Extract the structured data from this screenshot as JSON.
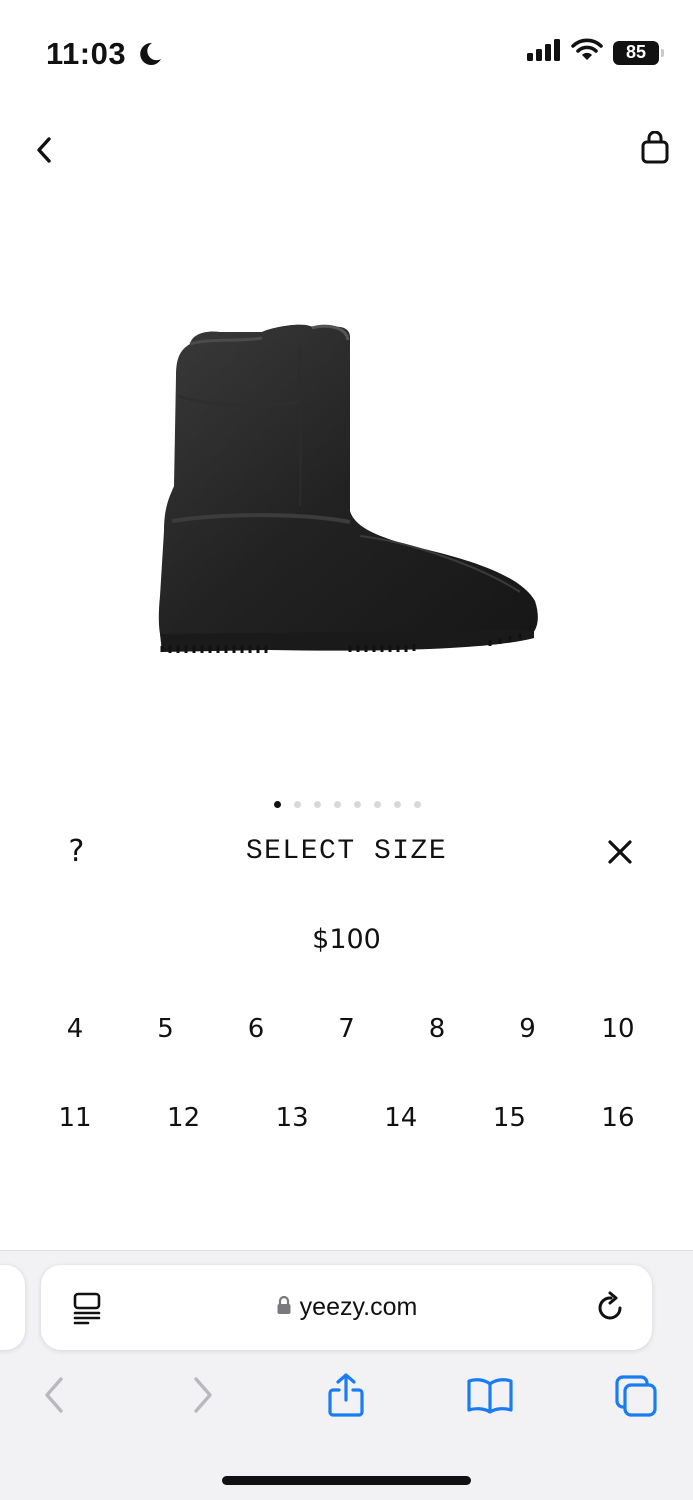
{
  "status_bar": {
    "time": "11:03",
    "battery": "85"
  },
  "product": {
    "image_alt": "black rubber boot",
    "carousel_count": 8,
    "carousel_active_index": 0
  },
  "size_panel": {
    "help_label": "?",
    "title": "SELECT SIZE",
    "price": "$100",
    "sizes_row1": [
      "4",
      "5",
      "6",
      "7",
      "8",
      "9",
      "10"
    ],
    "sizes_row2": [
      "11",
      "12",
      "13",
      "14",
      "15",
      "16"
    ]
  },
  "browser": {
    "url": "yeezy.com",
    "toolbar_icons": [
      "back-icon",
      "forward-icon",
      "share-icon",
      "bookmarks-icon",
      "tabs-icon"
    ],
    "accent_color": "#1a7cf2",
    "disabled_color": "#b8b8be"
  }
}
